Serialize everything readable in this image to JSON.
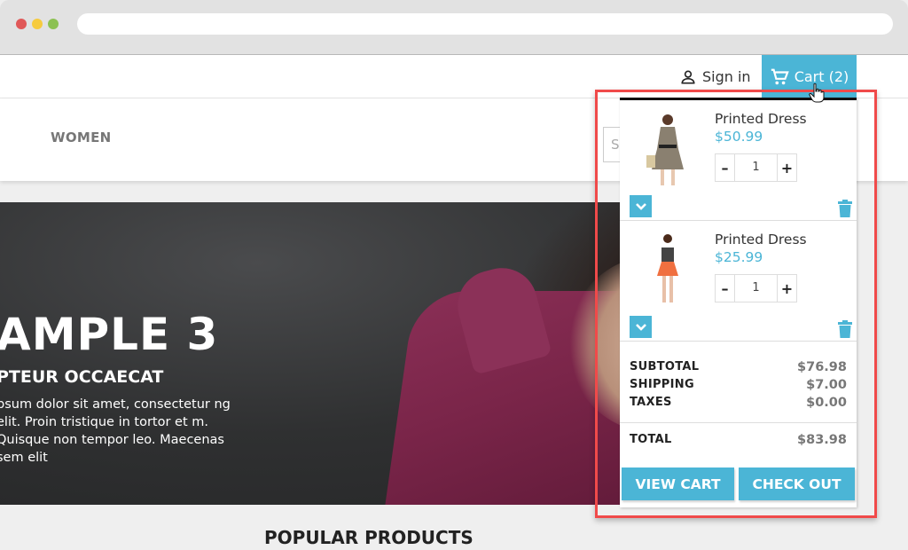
{
  "browser": {
    "url": ""
  },
  "header": {
    "signin_label": "Sign in",
    "cart_label": "Cart (2)",
    "cart_count": 2
  },
  "menu": {
    "items": [
      {
        "label": "WOMEN"
      }
    ],
    "search_placeholder": "S"
  },
  "hero": {
    "title": "AMPLE 3",
    "subtitle": "PTEUR OCCAECAT",
    "text": "psum dolor sit amet, consectetur ng elit. Proin tristique in tortor et m. Quisque non tempor leo. Maecenas sem elit"
  },
  "section": {
    "popular_title": "POPULAR PRODUCTS"
  },
  "cart": {
    "items": [
      {
        "name": "Printed Dress",
        "price": "$50.99",
        "quantity": "1"
      },
      {
        "name": "Printed Dress",
        "price": "$25.99",
        "quantity": "1"
      }
    ],
    "totals": {
      "subtotal_label": "SUBTOTAL",
      "subtotal": "$76.98",
      "shipping_label": "SHIPPING",
      "shipping": "$7.00",
      "taxes_label": "TAXES",
      "taxes": "$0.00",
      "total_label": "TOTAL",
      "total": "$83.98"
    },
    "view_cart_label": "VIEW CART",
    "checkout_label": "CHECK OUT"
  },
  "colors": {
    "accent": "#4bb5d6",
    "highlight": "#f04a4a"
  }
}
